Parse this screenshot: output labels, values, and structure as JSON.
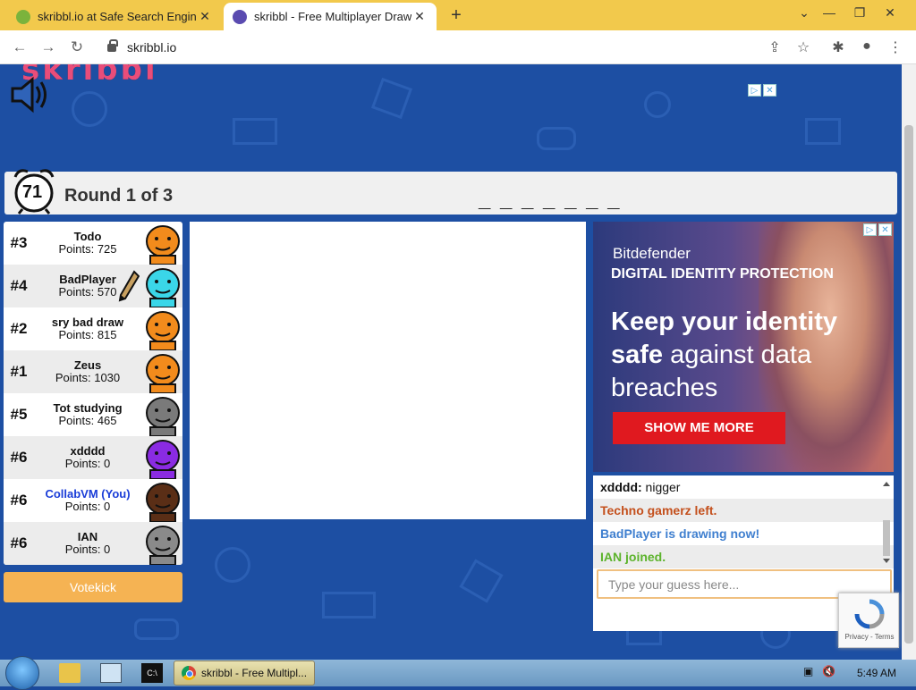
{
  "browser": {
    "tabs": [
      {
        "title": "skribbl.io at Safe Search Engine",
        "favicon_color": "#7bb33c",
        "active": false
      },
      {
        "title": "skribbl - Free Multiplayer Drawin",
        "favicon_color": "#5a4bb0",
        "active": true
      }
    ],
    "new_tab_icon": "plus-icon",
    "url": "skribbl.io"
  },
  "game": {
    "timer": "71",
    "round": "Round 1 of 3",
    "word_hint": "_ _ _ _ _ _ _",
    "players": [
      {
        "rank": "#3",
        "name": "Todo",
        "points": "Points: 725",
        "avatar_color": "#f28b1c",
        "you": false,
        "drawing": false
      },
      {
        "rank": "#4",
        "name": "BadPlayer",
        "points": "Points: 570",
        "avatar_color": "#3ad6e8",
        "you": false,
        "drawing": true
      },
      {
        "rank": "#2",
        "name": "sry bad draw",
        "points": "Points: 815",
        "avatar_color": "#f28b1c",
        "you": false,
        "drawing": false
      },
      {
        "rank": "#1",
        "name": "Zeus",
        "points": "Points: 1030",
        "avatar_color": "#f28b1c",
        "you": false,
        "drawing": false
      },
      {
        "rank": "#5",
        "name": "Tot studying",
        "points": "Points: 465",
        "avatar_color": "#7a7a7a",
        "you": false,
        "drawing": false
      },
      {
        "rank": "#6",
        "name": "xdddd",
        "points": "Points: 0",
        "avatar_color": "#8a2be2",
        "you": false,
        "drawing": false
      },
      {
        "rank": "#6",
        "name": "CollabVM (You)",
        "points": "Points: 0",
        "avatar_color": "#5a2e16",
        "you": true,
        "drawing": false
      },
      {
        "rank": "#6",
        "name": "IAN",
        "points": "Points: 0",
        "avatar_color": "#8a8a8a",
        "you": false,
        "drawing": false
      }
    ],
    "votekick_label": "Votekick",
    "chat": [
      {
        "user": "xdddd:",
        "text": " nigger",
        "kind": "plain"
      },
      {
        "user": "",
        "text": "Techno gamerz left.",
        "kind": "left"
      },
      {
        "user": "",
        "text": "BadPlayer is drawing now!",
        "kind": "draw"
      },
      {
        "user": "",
        "text": "IAN joined.",
        "kind": "join"
      }
    ],
    "guess_placeholder": "Type your guess here..."
  },
  "ad": {
    "brand": "Bitdefender",
    "subtitle": "DIGITAL IDENTITY PROTECTION",
    "headline_bold": "Keep your identity safe",
    "headline_rest": " against data breaches",
    "cta": "SHOW ME MORE"
  },
  "recaptcha": {
    "links": "Privacy - Terms"
  },
  "taskbar": {
    "app_label": "skribbl - Free Multipl...",
    "time": "5:49 AM"
  }
}
